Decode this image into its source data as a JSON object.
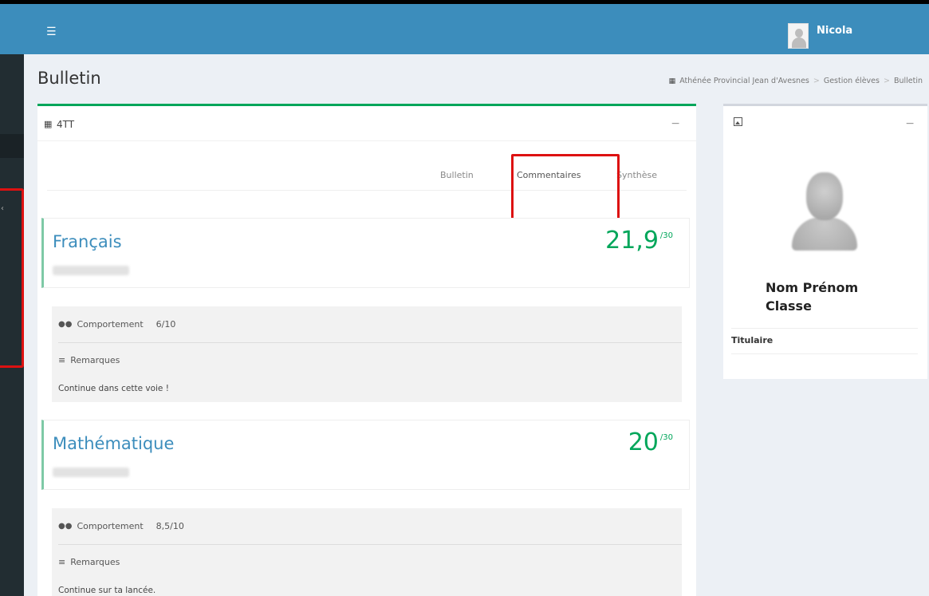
{
  "topbar": {
    "menu_icon": "hamburger-icon",
    "user_name": "Nicola",
    "brand_color": "#3c8dbc"
  },
  "page": {
    "title": "Bulletin"
  },
  "breadcrumb": {
    "icon": "grid-icon",
    "items": [
      "Athénée Provincial Jean d'Avesnes",
      "Gestion élèves",
      "Bulletin"
    ],
    "separator": ">"
  },
  "class_box": {
    "icon": "grid-icon",
    "class_name": "4TT",
    "collapse": "−",
    "tabs": [
      "Bulletin",
      "Commentaires",
      "Synthèse"
    ],
    "active_tab": "Commentaires"
  },
  "subjects": [
    {
      "name": "Français",
      "score": "21,9",
      "max": "/30",
      "behavior_label": "Comportement",
      "behavior_value": "6/10",
      "remarks_label": "Remarques",
      "remark": "Continue dans cette voie !"
    },
    {
      "name": "Mathématique",
      "score": "20",
      "max": "/30",
      "behavior_label": "Comportement",
      "behavior_value": "8,5/10",
      "remarks_label": "Remarques",
      "remark": "Continue sur ta lancée."
    }
  ],
  "profile": {
    "icon": "image-icon",
    "collapse": "−",
    "name": "Nom Prénom",
    "class": "Classe",
    "titulaire_label": "Titulaire"
  },
  "colors": {
    "accent_green": "#00a65a",
    "highlight_red": "#dd1111",
    "link_blue": "#3c8dbc"
  }
}
